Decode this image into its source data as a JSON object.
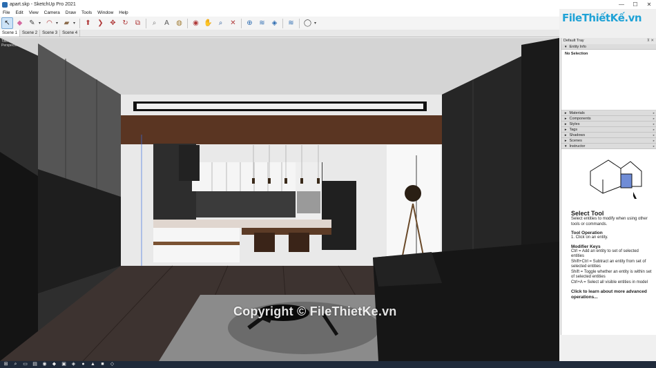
{
  "window": {
    "title": "apart.skp - SketchUp Pro 2021"
  },
  "window_controls": [
    "—",
    "☐",
    "✕"
  ],
  "menu": [
    "File",
    "Edit",
    "View",
    "Camera",
    "Draw",
    "Tools",
    "Window",
    "Help"
  ],
  "scenes": [
    "Scene 1",
    "Scene 2",
    "Scene 3",
    "Scene 4"
  ],
  "viewport": {
    "camera_label_1": "Two Point",
    "camera_label_2": "Perspective"
  },
  "watermark": "Copyright © FileThietKe.vn",
  "logo": "FileThiếtKế.vn",
  "tray": {
    "title": "Default Tray",
    "entity_info": {
      "header": "Entity Info",
      "value": "No Selection"
    },
    "collapsed_panels": [
      "Materials",
      "Components",
      "Styles",
      "Tags",
      "Shadows",
      "Scenes"
    ],
    "instructor": {
      "header": "Instructor",
      "tool_title": "Select Tool",
      "tool_desc": "Select entities to modify when using other tools or commands.",
      "operation_title": "Tool Operation",
      "operation_step": "1. Click on an entity.",
      "modifier_title": "Modifier Keys",
      "modifiers": [
        "Ctrl = Add an entity to set of selected entities",
        "Shift+Ctrl = Subtract an entity from set of selected entities",
        "Shift = Toggle whether an entity is within set of selected entities",
        "Ctrl+A = Select all visible entities in model"
      ],
      "link": "Click to learn about more advanced operations..."
    }
  },
  "colors": {
    "accent": "#1fa2d6",
    "viewport_bg": "#3a3a3a",
    "floor": "#3d3330"
  }
}
